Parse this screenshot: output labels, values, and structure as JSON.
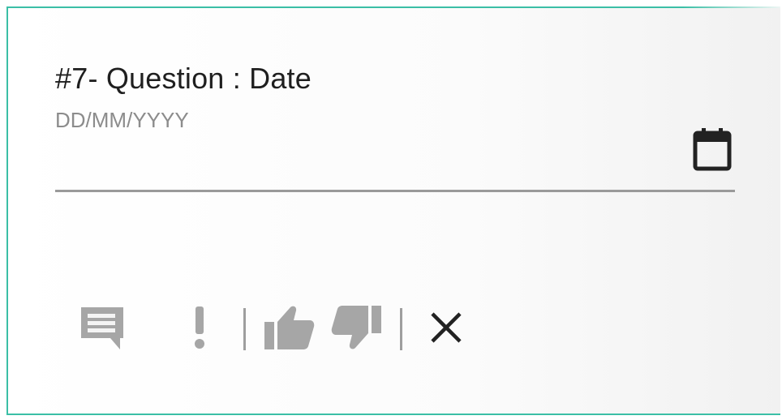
{
  "question": {
    "label": "#7- Question : Date"
  },
  "date_field": {
    "placeholder": "DD/MM/YYYY",
    "value": ""
  },
  "icons": {
    "calendar": "calendar-icon",
    "comment": "comment-icon",
    "important": "exclamation-icon",
    "like": "thumbs-up-icon",
    "dislike": "thumbs-down-icon",
    "close": "close-icon"
  },
  "colors": {
    "accent_border": "#3bbfa6",
    "icon_muted": "#a6a6a6",
    "icon_dark": "#222222",
    "text_primary": "#1f1f1f",
    "text_placeholder": "#8c8c8c"
  }
}
